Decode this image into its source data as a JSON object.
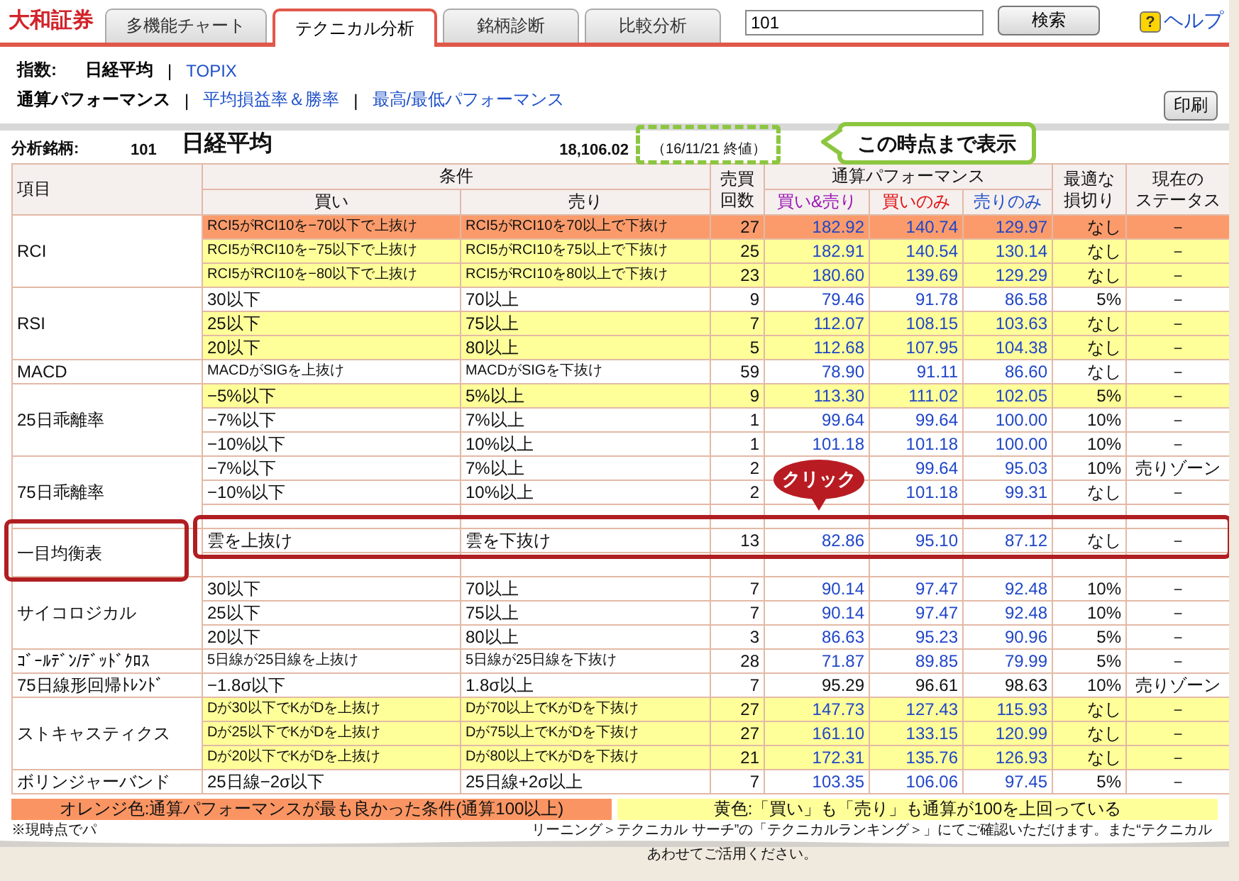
{
  "brand": "大和証券",
  "tabs": [
    {
      "label": "多機能チャート",
      "selected": false
    },
    {
      "label": "テクニカル分析",
      "selected": true
    },
    {
      "label": "銘柄診断",
      "selected": false
    },
    {
      "label": "比較分析",
      "selected": false
    }
  ],
  "search": {
    "value": "101",
    "button": "検索"
  },
  "help": "ヘルプ",
  "help_mark": "?",
  "index_nav": {
    "label": "指数:",
    "separator": "|",
    "items": [
      {
        "label": "日経平均",
        "selected": true
      },
      {
        "label": "TOPIX",
        "selected": false
      }
    ]
  },
  "view_nav": {
    "separator": "|",
    "items": [
      {
        "label": "通算パフォーマンス",
        "selected": true
      },
      {
        "label": "平均損益率＆勝率",
        "selected": false
      },
      {
        "label": "最高/最低パフォーマンス",
        "selected": false
      }
    ]
  },
  "print_button": "印刷",
  "analysis": {
    "label": "分析銘柄:",
    "code": "101",
    "name": "日経平均",
    "price": "18,106.02",
    "date": "（16/11/21 終値）"
  },
  "table": {
    "headers": {
      "item": "項目",
      "condition": "条件",
      "buy": "買い",
      "sell": "売り",
      "count": [
        "売買",
        "回数"
      ],
      "performance": "通算パフォーマンス",
      "both": "買い&売り",
      "buy_only": "買いのみ",
      "sell_only": "売りのみ",
      "stop": [
        "最適な",
        "損切り"
      ],
      "status": [
        "現在の",
        "ステータス"
      ]
    },
    "groups": [
      {
        "name": "RCI",
        "rows": [
          {
            "buy": "RCI5がRCI10を−70以下で上抜け",
            "sell": "RCI5がRCI10を70以上で下抜け",
            "small": true,
            "count": "27",
            "both": "182.92",
            "buy_only": "140.74",
            "sell_only": "129.97",
            "linked": true,
            "stop": "なし",
            "status": "－",
            "color": "#fb9b6b"
          },
          {
            "buy": "RCI5がRCI10を−75以下で上抜け",
            "sell": "RCI5がRCI10を75以上で下抜け",
            "small": true,
            "count": "25",
            "both": "182.91",
            "buy_only": "140.54",
            "sell_only": "130.14",
            "linked": true,
            "stop": "なし",
            "status": "－",
            "color": "#ffff99"
          },
          {
            "buy": "RCI5がRCI10を−80以下で上抜け",
            "sell": "RCI5がRCI10を80以上で下抜け",
            "small": true,
            "count": "23",
            "both": "180.60",
            "buy_only": "139.69",
            "sell_only": "129.29",
            "linked": true,
            "stop": "なし",
            "status": "－",
            "color": "#ffff99"
          }
        ]
      },
      {
        "name": "RSI",
        "rows": [
          {
            "buy": "30以下",
            "sell": "70以上",
            "small": false,
            "count": "9",
            "both": "79.46",
            "buy_only": "91.78",
            "sell_only": "86.58",
            "linked": true,
            "stop": "5%",
            "status": "－",
            "color": "#ffffff"
          },
          {
            "buy": "25以下",
            "sell": "75以上",
            "small": false,
            "count": "7",
            "both": "112.07",
            "buy_only": "108.15",
            "sell_only": "103.63",
            "linked": true,
            "stop": "なし",
            "status": "－",
            "color": "#ffff99"
          },
          {
            "buy": "20以下",
            "sell": "80以上",
            "small": false,
            "count": "5",
            "both": "112.68",
            "buy_only": "107.95",
            "sell_only": "104.38",
            "linked": true,
            "stop": "なし",
            "status": "－",
            "color": "#ffff99"
          }
        ]
      },
      {
        "name": "MACD",
        "rows": [
          {
            "buy": "MACDがSIGを上抜け",
            "sell": "MACDがSIGを下抜け",
            "small": true,
            "count": "59",
            "both": "78.90",
            "buy_only": "91.11",
            "sell_only": "86.60",
            "linked": true,
            "stop": "なし",
            "status": "－",
            "color": "#ffffff"
          }
        ]
      },
      {
        "name": "25日乖離率",
        "rows": [
          {
            "buy": "−5%以下",
            "sell": "5%以上",
            "small": false,
            "count": "9",
            "both": "113.30",
            "buy_only": "111.02",
            "sell_only": "102.05",
            "linked": true,
            "stop": "5%",
            "status": "－",
            "color": "#ffff99"
          },
          {
            "buy": "−7%以下",
            "sell": "7%以上",
            "small": false,
            "count": "1",
            "both": "99.64",
            "buy_only": "99.64",
            "sell_only": "100.00",
            "linked": true,
            "stop": "10%",
            "status": "－",
            "color": "#ffffff"
          },
          {
            "buy": "−10%以下",
            "sell": "10%以上",
            "small": false,
            "count": "1",
            "both": "101.18",
            "buy_only": "101.18",
            "sell_only": "100.00",
            "linked": true,
            "stop": "10%",
            "status": "－",
            "color": "#ffffff"
          }
        ]
      },
      {
        "name": "75日乖離率",
        "rows": [
          {
            "buy": "−7%以下",
            "sell": "7%以上",
            "small": false,
            "count": "2",
            "buy_only": "99.64",
            "sell_only": "95.03",
            "linked": true,
            "stop": "10%",
            "status": "売りゾーン",
            "color": "#ffffff"
          },
          {
            "buy": "−10%以下",
            "sell": "10%以上",
            "small": false,
            "count": "2",
            "buy_only": "101.18",
            "sell_only": "99.31",
            "linked": true,
            "stop": "なし",
            "status": "－",
            "color": "#ffffff"
          },
          {
            "color": "#ffffff"
          }
        ]
      },
      {
        "name": "一目均衡表",
        "rows": [
          {
            "buy": "雲を上抜け",
            "sell": "雲を下抜け",
            "small": false,
            "count": "13",
            "both": "82.86",
            "buy_only": "95.10",
            "sell_only": "87.12",
            "linked": true,
            "stop": "なし",
            "status": "－",
            "color": "#ffffff"
          },
          {
            "color": "#ffffff"
          }
        ]
      },
      {
        "name": "サイコロジカル",
        "rows": [
          {
            "buy": "30以下",
            "sell": "70以上",
            "small": false,
            "count": "7",
            "both": "90.14",
            "buy_only": "97.47",
            "sell_only": "92.48",
            "linked": true,
            "stop": "10%",
            "status": "－",
            "color": "#ffffff"
          },
          {
            "buy": "25以下",
            "sell": "75以上",
            "small": false,
            "count": "7",
            "both": "90.14",
            "buy_only": "97.47",
            "sell_only": "92.48",
            "linked": true,
            "stop": "10%",
            "status": "－",
            "color": "#ffffff"
          },
          {
            "buy": "20以下",
            "sell": "80以上",
            "small": false,
            "count": "3",
            "both": "86.63",
            "buy_only": "95.23",
            "sell_only": "90.96",
            "linked": true,
            "stop": "5%",
            "status": "－",
            "color": "#ffffff"
          }
        ]
      },
      {
        "name": "ｺﾞｰﾙﾃﾞﾝ/ﾃﾞｯﾄﾞｸﾛｽ",
        "rows": [
          {
            "buy": "5日線が25日線を上抜け",
            "sell": "5日線が25日線を下抜け",
            "small": true,
            "count": "28",
            "both": "71.87",
            "buy_only": "89.85",
            "sell_only": "79.99",
            "linked": true,
            "stop": "5%",
            "status": "－",
            "color": "#ffffff"
          }
        ]
      },
      {
        "name": "75日線形回帰ﾄﾚﾝﾄﾞ",
        "rows": [
          {
            "buy": "−1.8σ以下",
            "sell": "1.8σ以上",
            "small": false,
            "count": "7",
            "both": "95.29",
            "buy_only": "96.61",
            "sell_only": "98.63",
            "linked": false,
            "stop": "10%",
            "status": "売りゾーン",
            "color": "#ffffff"
          }
        ]
      },
      {
        "name": "ストキャスティクス",
        "rows": [
          {
            "buy": "Dが30以下でKがDを上抜け",
            "sell": "Dが70以上でKがDを下抜け",
            "small": true,
            "count": "27",
            "both": "147.73",
            "buy_only": "127.43",
            "sell_only": "115.93",
            "linked": true,
            "stop": "なし",
            "status": "－",
            "color": "#ffff99"
          },
          {
            "buy": "Dが25以下でKがDを上抜け",
            "sell": "Dが75以上でKがDを下抜け",
            "small": true,
            "count": "27",
            "both": "161.10",
            "buy_only": "133.15",
            "sell_only": "120.99",
            "linked": true,
            "stop": "なし",
            "status": "－",
            "color": "#ffff99"
          },
          {
            "buy": "Dが20以下でKがDを上抜け",
            "sell": "Dが80以上でKがDを下抜け",
            "small": true,
            "count": "21",
            "both": "172.31",
            "buy_only": "135.76",
            "sell_only": "126.93",
            "linked": true,
            "stop": "なし",
            "status": "－",
            "color": "#ffff99"
          }
        ]
      },
      {
        "name": "ボリンジャーバンド",
        "rows": [
          {
            "buy": "25日線−2σ以下",
            "sell": "25日線+2σ以上",
            "small": false,
            "count": "7",
            "both": "103.35",
            "buy_only": "106.06",
            "sell_only": "97.45",
            "linked": true,
            "stop": "5%",
            "status": "－",
            "color": "#ffffff"
          }
        ]
      }
    ]
  },
  "legend": [
    {
      "text": "オレンジ色:通算パフォーマンスが最も良かった条件(通算100以上)",
      "color": "#fa9563"
    },
    {
      "text": "黄色:「買い」も「売り」も通算が100を上回っている",
      "color": "#ffff99"
    }
  ],
  "footnote": {
    "line1_left": "※現時点でパ",
    "line1_right": "リーニング＞テクニカル サーチ”の「テクニカルランキング＞」にてご確認いただけます。また“テクニカル",
    "line2_right": "あわせてご活用ください。"
  },
  "annotations": {
    "click": "クリック",
    "callout": "この時点まで表示"
  }
}
